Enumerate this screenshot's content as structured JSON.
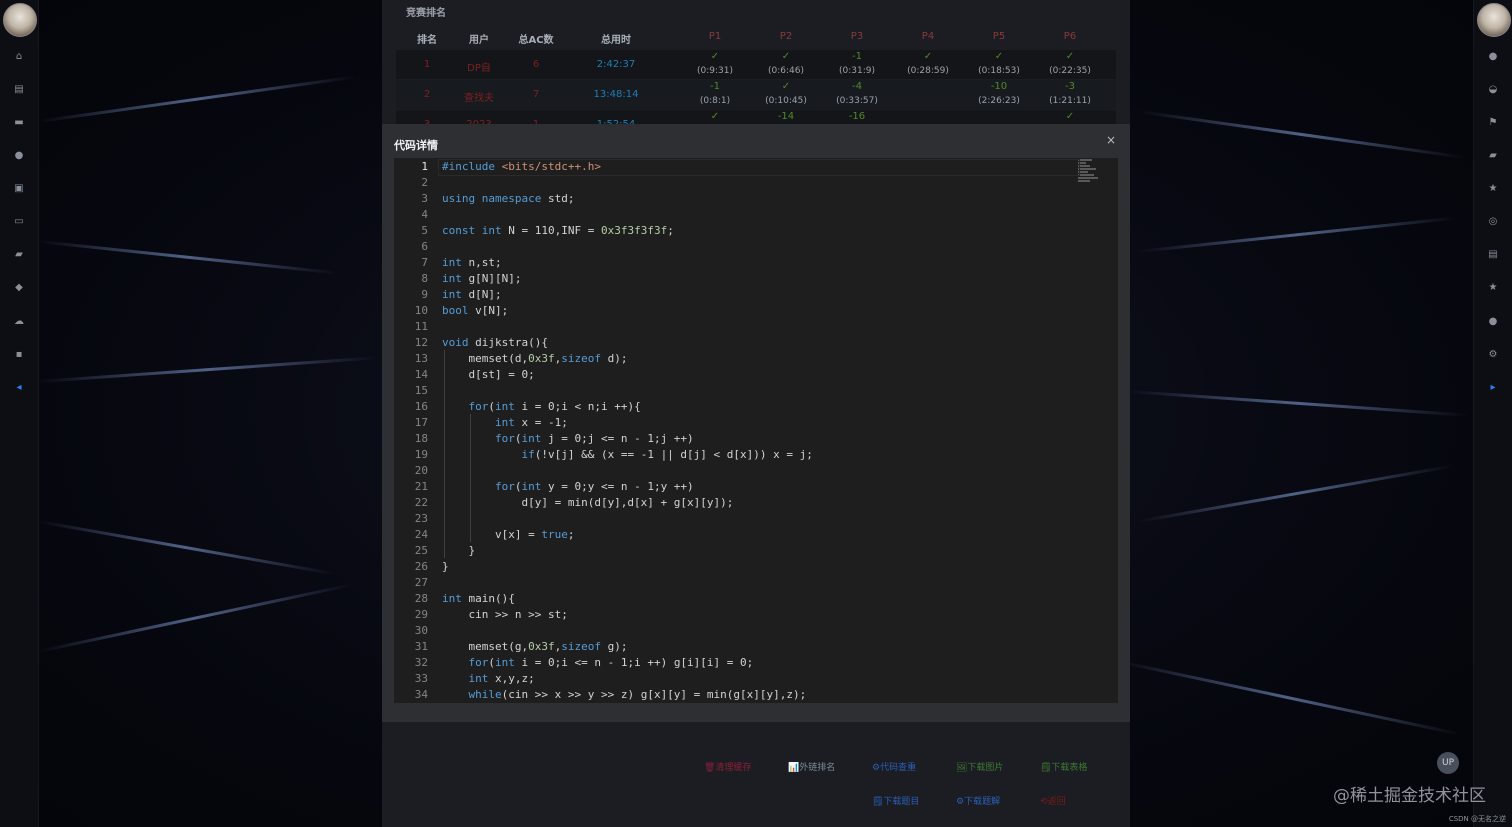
{
  "rank_section": {
    "title": "竞赛排名",
    "headers": {
      "rank": "排名",
      "user": "用户",
      "ac": "总AC数",
      "time": "总用时"
    },
    "problems": [
      "P1",
      "P2",
      "P3",
      "P4",
      "P5",
      "P6"
    ],
    "rows": [
      {
        "rank": "1",
        "user": "DP自",
        "ac": "6",
        "time": "2:42:37",
        "cells": [
          {
            "mark": "✓",
            "time": "(0:9:31)"
          },
          {
            "mark": "✓",
            "time": "(0:6:46)"
          },
          {
            "mark": "-1",
            "time": "(0:31:9)"
          },
          {
            "mark": "✓",
            "time": "(0:28:59)"
          },
          {
            "mark": "✓",
            "time": "(0:18:53)"
          },
          {
            "mark": "✓",
            "time": "(0:22:35)"
          }
        ]
      },
      {
        "rank": "2",
        "user": "查找夫",
        "ac": "7",
        "time": "13:48:14",
        "cells": [
          {
            "mark": "-1",
            "time": "(0:8:1)"
          },
          {
            "mark": "✓",
            "time": "(0:10:45)"
          },
          {
            "mark": "-4",
            "time": "(0:33:57)"
          },
          {
            "mark": "",
            "time": ""
          },
          {
            "mark": "-10",
            "time": "(2:26:23)"
          },
          {
            "mark": "-3",
            "time": "(1:21:11)"
          }
        ]
      },
      {
        "rank": "3",
        "user": "2023",
        "ac": "1",
        "time": "1:52:54",
        "cells": [
          {
            "mark": "✓",
            "time": ""
          },
          {
            "mark": "-14",
            "time": ""
          },
          {
            "mark": "-16",
            "time": ""
          },
          {
            "mark": "",
            "time": ""
          },
          {
            "mark": "",
            "time": ""
          },
          {
            "mark": "✓",
            "time": ""
          }
        ]
      }
    ]
  },
  "modal": {
    "title": "代码详情",
    "close_glyph": "×",
    "code": [
      "#include <bits/stdc++.h>",
      "",
      "using namespace std;",
      "",
      "const int N = 110,INF = 0x3f3f3f3f;",
      "",
      "int n,st;",
      "int g[N][N];",
      "int d[N];",
      "bool v[N];",
      "",
      "void dijkstra(){",
      "    memset(d,0x3f,sizeof d);",
      "    d[st] = 0;",
      "",
      "    for(int i = 0;i < n;i ++){",
      "        int x = -1;",
      "        for(int j = 0;j <= n - 1;j ++)",
      "            if(!v[j] && (x == -1 || d[j] < d[x])) x = j;",
      "",
      "        for(int y = 0;y <= n - 1;y ++)",
      "            d[y] = min(d[y],d[x] + g[x][y]);",
      "",
      "        v[x] = true;",
      "    }",
      "}",
      "",
      "int main(){",
      "    cin >> n >> st;",
      "",
      "    memset(g,0x3f,sizeof g);",
      "    for(int i = 0;i <= n - 1;i ++) g[i][i] = 0;",
      "    int x,y,z;",
      "    while(cin >> x >> y >> z) g[x][y] = min(g[x][y],z);"
    ]
  },
  "toolbar": {
    "clear_cache": "🗑清理缓存",
    "external_rank": "📊外链排名",
    "code_check": "⚙代码查重",
    "download_image": "🖼下载图片",
    "download_table": "🗒下载表格",
    "download_problems": "🗒下载题目",
    "download_solutions": "⚙下载题解",
    "return": "⟲返回"
  },
  "colors": {
    "clear_cache": "#8b1f3a",
    "external_rank": "#7b8c9a",
    "blue_btn": "#2b5fb8",
    "green_btn": "#3e7a34",
    "red_btn": "#7a1a1a"
  },
  "watermark": "@稀土掘金技术社区",
  "up_badge": "UP",
  "csdn_mark": "CSDN @无名之逆"
}
